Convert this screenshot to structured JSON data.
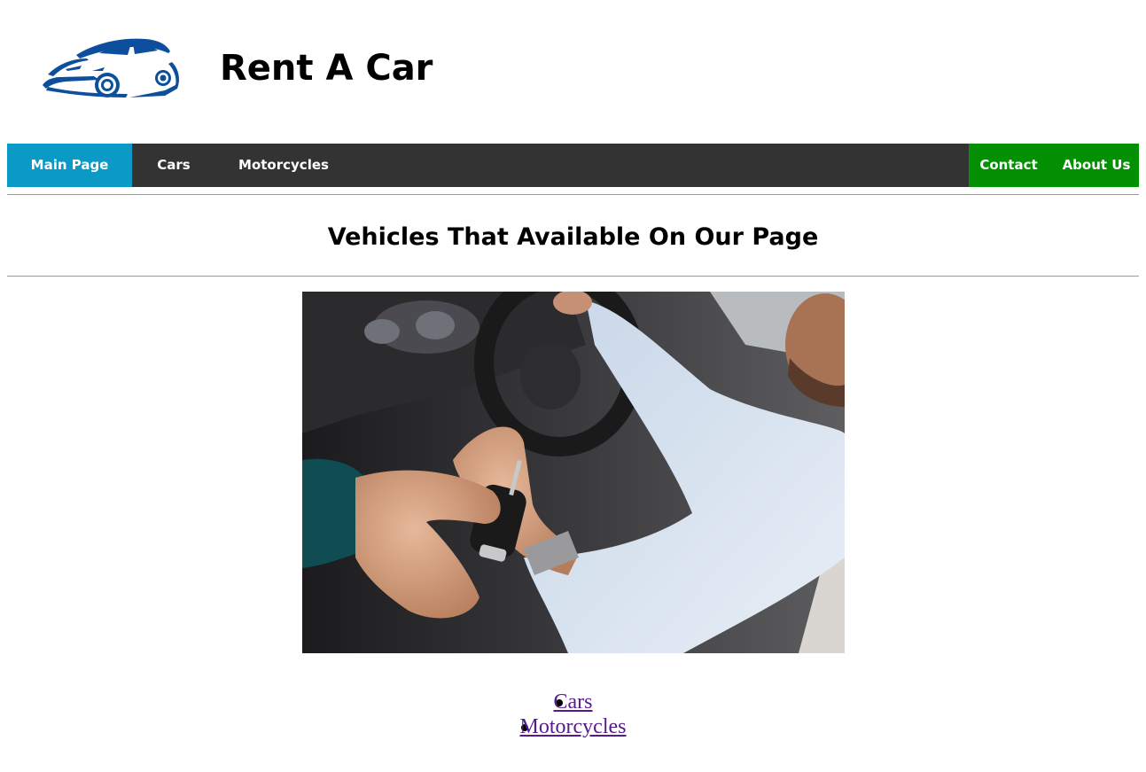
{
  "header": {
    "title": "Rent A Car",
    "logo_icon": "car-logo-icon",
    "logo_color": "#0d4f9c"
  },
  "nav": {
    "left_items": [
      {
        "label": "Main Page",
        "active": true
      },
      {
        "label": "Cars",
        "active": false
      },
      {
        "label": "Motorcycles",
        "active": false
      }
    ],
    "right_items": [
      {
        "label": "Contact"
      },
      {
        "label": "About Us"
      }
    ],
    "colors": {
      "bar": "#333333",
      "active": "#0b99c5",
      "right_group": "#039003"
    }
  },
  "main": {
    "heading": "Vehicles That Available On Our Page",
    "hero_image": "car-key-handover-photo",
    "links": [
      {
        "label": "Cars"
      },
      {
        "label": "Motorcycles"
      }
    ],
    "link_color": "#551a8b"
  }
}
